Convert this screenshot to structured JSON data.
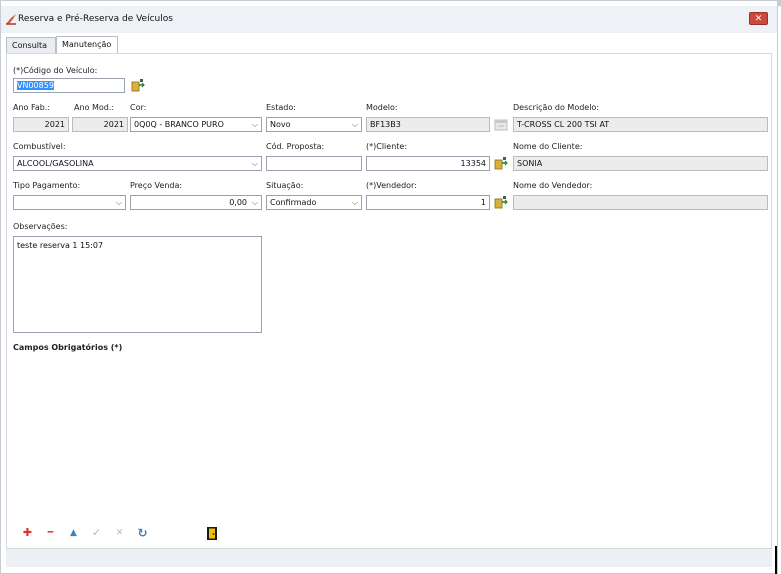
{
  "window": {
    "title": "Reserva e Pré-Reserva de Veículos",
    "close": "✕"
  },
  "tabs": [
    {
      "label": "Consulta"
    },
    {
      "label": "Manutenção"
    }
  ],
  "form": {
    "codigo": {
      "label": "(*)Código do Veículo:",
      "value": "VN00859"
    },
    "ano_fab": {
      "label": "Ano Fab.:",
      "value": "2021"
    },
    "ano_mod": {
      "label": "Ano Mod.:",
      "value": "2021"
    },
    "cor": {
      "label": "Cor:",
      "value": "0Q0Q - BRANCO PURO"
    },
    "estado": {
      "label": "Estado:",
      "value": "Novo"
    },
    "modelo": {
      "label": "Modelo:",
      "value": "BF13B3"
    },
    "descricao": {
      "label": "Descrição do Modelo:",
      "value": "T-CROSS CL 200 TSI AT"
    },
    "combustivel": {
      "label": "Combustível:",
      "value": "ALCOOL/GASOLINA"
    },
    "cod_proposta": {
      "label": "Cód. Proposta:",
      "value": ""
    },
    "cliente": {
      "label": "(*)Cliente:",
      "value": "13354"
    },
    "nome_cliente": {
      "label": "Nome do Cliente:",
      "value": "SONIA"
    },
    "tipo_pagamento": {
      "label": "Tipo Pagamento:",
      "value": ""
    },
    "preco_venda": {
      "label": "Preço Venda:",
      "value": "0,00"
    },
    "situacao": {
      "label": "Situação:",
      "value": "Confirmado"
    },
    "vendedor": {
      "label": "(*)Vendedor:",
      "value": "1"
    },
    "nome_vendedor": {
      "label": "Nome do Vendedor:",
      "value": ""
    },
    "observacoes": {
      "label": "Observações:",
      "value": "teste reserva 1 15:07"
    },
    "obrigatorios": "Campos Obrigatórios (*)"
  },
  "toolbar": {
    "add": "✚",
    "remove": "━",
    "up": "▲",
    "confirm": "✓",
    "cancel": "✕",
    "refresh": "↻"
  },
  "colors": {
    "accent_red": "#e0342a",
    "accent_blue": "#3f7fc4",
    "selection": "#3390ff"
  },
  "icons": [
    "app-icon",
    "lookup-icon",
    "calendar-icon",
    "exit-door-icon"
  ]
}
